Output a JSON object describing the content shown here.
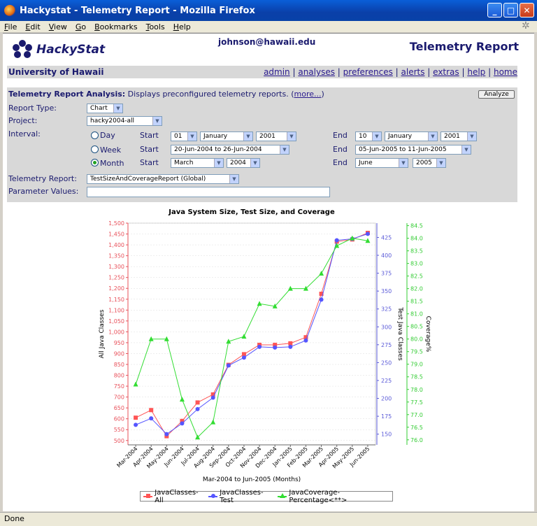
{
  "window": {
    "title": "Hackystat - Telemetry Report - Mozilla Firefox",
    "min": "_",
    "max": "□",
    "close": "✕"
  },
  "menu": [
    "File",
    "Edit",
    "View",
    "Go",
    "Bookmarks",
    "Tools",
    "Help"
  ],
  "header": {
    "logo_text": "HackyStat",
    "user_email": "johnson@hawaii.edu",
    "page_title": "Telemetry Report"
  },
  "nav": {
    "org": "University of Hawaii",
    "links": [
      "admin",
      "analyses",
      "preferences",
      "alerts",
      "extras",
      "help",
      "home"
    ]
  },
  "analysis": {
    "heading_bold": "Telemetry Report Analysis:",
    "heading_text": " Displays preconfigured telemetry reports. (",
    "more_link": "more...",
    "heading_close": ")",
    "analyze_button": "Analyze",
    "report_type_label": "Report Type:",
    "report_type": "Chart",
    "project_label": "Project:",
    "project": "hacky2004-all",
    "interval_label": "Interval:",
    "day_label": "Day",
    "week_label": "Week",
    "month_label": "Month",
    "selected_interval": "Month",
    "start_label": "Start",
    "end_label": "End",
    "day_start": {
      "day": "01",
      "month": "January",
      "year": "2001"
    },
    "day_end": {
      "day": "10",
      "month": "January",
      "year": "2001"
    },
    "week_start": "20-Jun-2004 to 26-Jun-2004",
    "week_end": "05-Jun-2005 to 11-Jun-2005",
    "month_start": {
      "month": "March",
      "year": "2004"
    },
    "month_end": {
      "month": "June",
      "year": "2005"
    },
    "telemetry_report_label": "Telemetry Report:",
    "telemetry_report": "TestSizeAndCoverageReport (Global)",
    "parameter_values_label": "Parameter Values:",
    "parameter_values": ""
  },
  "chart_data": {
    "type": "line",
    "title": "Java System Size, Test Size, and Coverage",
    "xlabel": "Mar-2004 to Jun-2005 (Months)",
    "categories": [
      "Mar-2004",
      "Apr-2004",
      "May-2004",
      "Jun-2004",
      "Jul-2004",
      "Aug-2004",
      "Sep-2004",
      "Oct-2004",
      "Nov-2004",
      "Dec-2004",
      "Jan-2005",
      "Feb-2005",
      "Mar-2005",
      "Apr-2005",
      "May-2005",
      "Jun-2005"
    ],
    "axes": [
      {
        "name": "All Java Classes",
        "side": "left",
        "range": [
          480,
          1500
        ],
        "ticks": [
          500,
          550,
          600,
          650,
          700,
          750,
          800,
          850,
          900,
          950,
          1000,
          1050,
          1100,
          1150,
          1200,
          1250,
          1300,
          1350,
          1400,
          1450,
          1500
        ],
        "tick_labels": [
          "500",
          "550",
          "600",
          "650",
          "700",
          "750",
          "800",
          "850",
          "900",
          "950",
          "1,000",
          "1,050",
          "1,100",
          "1,150",
          "1,200",
          "1,250",
          "1,300",
          "1,350",
          "1,400",
          "1,450",
          "1,500"
        ],
        "color": "#e8505a"
      },
      {
        "name": "Test Java Classes",
        "side": "right",
        "range": [
          135,
          445
        ],
        "ticks": [
          150,
          175,
          200,
          225,
          250,
          275,
          300,
          325,
          350,
          375,
          400,
          425
        ],
        "tick_labels": [
          "150",
          "175",
          "200",
          "225",
          "250",
          "275",
          "300",
          "325",
          "350",
          "375",
          "400",
          "425"
        ],
        "color": "#5a5ad8"
      },
      {
        "name": "Coverage%",
        "side": "right2",
        "range": [
          75.8,
          84.6
        ],
        "ticks": [
          76.0,
          76.5,
          77.0,
          77.5,
          78.0,
          78.5,
          79.0,
          79.5,
          80.0,
          80.5,
          81.0,
          81.5,
          82.0,
          82.5,
          83.0,
          83.5,
          84.0,
          84.5
        ],
        "tick_labels": [
          "76.0",
          "76.5",
          "77.0",
          "77.5",
          "78.0",
          "78.5",
          "79.0",
          "79.5",
          "80.0",
          "80.5",
          "81.0",
          "81.5",
          "82.0",
          "82.5",
          "83.0",
          "83.5",
          "84.0",
          "84.5"
        ],
        "color": "#33cc33"
      }
    ],
    "series": [
      {
        "name": "JavaClasses-All",
        "axis": 0,
        "color": "#ff5555",
        "marker": "square",
        "values": [
          605,
          640,
          520,
          590,
          675,
          712,
          848,
          897,
          940,
          940,
          947,
          975,
          1175,
          1415,
          1425,
          1455
        ]
      },
      {
        "name": "JavaClasses-Test",
        "axis": 1,
        "color": "#5555ff",
        "marker": "circle",
        "values": [
          163,
          172,
          150,
          165,
          185,
          201,
          246,
          257,
          272,
          271,
          272,
          281,
          338,
          421,
          423,
          430
        ]
      },
      {
        "name": "JavaCoverage-Percentage<**>",
        "axis": 2,
        "color": "#33dd33",
        "marker": "triangle",
        "values": [
          78.2,
          80.0,
          80.0,
          77.6,
          76.1,
          76.7,
          79.9,
          80.1,
          81.4,
          81.3,
          82.0,
          82.0,
          82.6,
          83.7,
          84.0,
          83.9
        ]
      }
    ],
    "grid": true,
    "legend": "bottom"
  },
  "status": "Done"
}
